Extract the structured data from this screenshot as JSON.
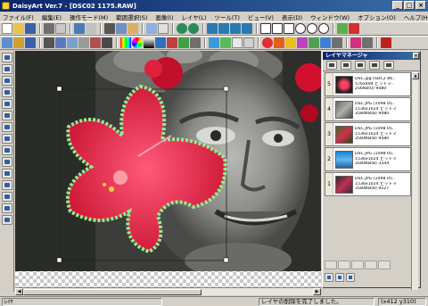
{
  "window": {
    "title": "DaisyArt Ver.7 - [DSC02 1175.RAW]",
    "buttons": [
      "_",
      "□",
      "×"
    ]
  },
  "menu": [
    "ファイル(F)",
    "編集(E)",
    "操作モード(M)",
    "範囲選択(S)",
    "画像(I)",
    "レイヤ(L)",
    "ツール(T)",
    "ビュー(V)",
    "表示(D)",
    "ウィンドウ(W)",
    "オプション(O)",
    "ヘルプ(H)"
  ],
  "layer_manager": {
    "title": "レイヤマネージャ",
    "close": "×",
    "layers": [
      {
        "num": "5",
        "line1": "DSC.jpg [SDC2 86..",
        "line2": "576x494 ビットマ..",
        "line3": "256KB(0) 9480"
      },
      {
        "num": "4",
        "line1": "DSC.JPG [1098 05..",
        "line2": "1536x1024 ビットマ",
        "line3": "3584KB(8) 9480"
      },
      {
        "num": "3",
        "line1": "DSC.JPG [1098 05..",
        "line2": "1536x1024 ビットマ",
        "line3": "3584KB(8) 9480"
      },
      {
        "num": "2",
        "line1": "DSC.JPG [1098 05..",
        "line2": "1536x1024 ビットマ",
        "line3": "3584KB(8) 3344"
      },
      {
        "num": "1",
        "line1": "DSC.JPG [1098 05..",
        "line2": "1536x1024 ビットマ",
        "line3": "3584KB(8) 9227"
      }
    ]
  },
  "status": {
    "left": "ﾚｲﾔ",
    "message": "レイヤの削除を完了しました。",
    "coords": "(x412 y310)"
  },
  "colors": {
    "selection": "#90ee90",
    "flower": "#e01a3c",
    "titlebar": "#0a246a"
  }
}
